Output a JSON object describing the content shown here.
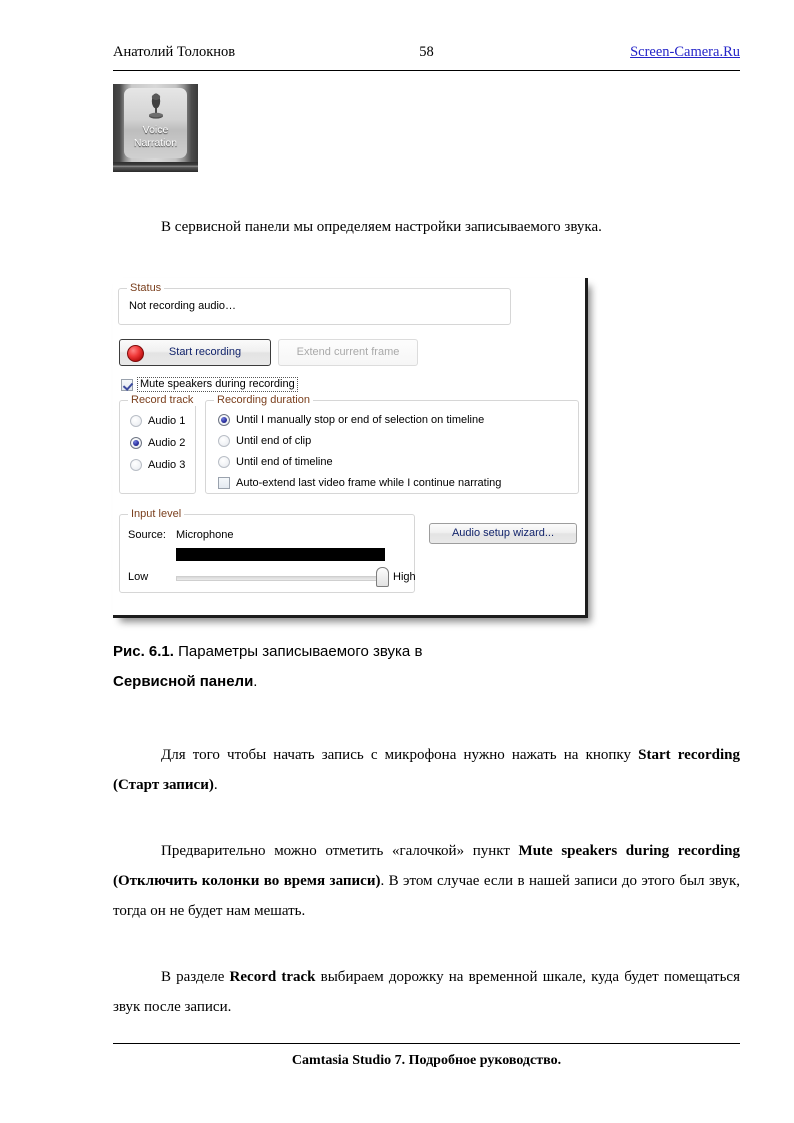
{
  "header": {
    "author": "Анатолий Толокнов",
    "page_number": "58",
    "link": "Screen-Camera.Ru",
    "link_color": "#2424c8"
  },
  "toolbutton": {
    "label_line1": "Voice",
    "label_line2": "Narration",
    "icon": "microphone-icon"
  },
  "intro_paragraph": "В сервисной панели мы определяем настройки записываемого звука.",
  "dialog": {
    "status": {
      "legend": "Status",
      "text": "Not recording audio…"
    },
    "buttons": {
      "start_recording": "Start recording",
      "extend_current_frame": "Extend current frame",
      "audio_setup_wizard": "Audio setup wizard..."
    },
    "mute": {
      "label": "Mute speakers during recording",
      "checked": true
    },
    "record_track": {
      "legend": "Record track",
      "options": [
        {
          "label": "Audio 1",
          "selected": false
        },
        {
          "label": "Audio 2",
          "selected": true
        },
        {
          "label": "Audio 3",
          "selected": false
        }
      ]
    },
    "recording_duration": {
      "legend": "Recording duration",
      "options": [
        {
          "label": "Until I manually stop or end of selection on timeline",
          "selected": true
        },
        {
          "label": "Until end of clip",
          "selected": false
        },
        {
          "label": "Until end of timeline",
          "selected": false
        }
      ],
      "auto_extend": {
        "label": "Auto-extend last video frame while I continue narrating",
        "checked": false
      }
    },
    "input_level": {
      "legend": "Input level",
      "source_label": "Source:",
      "source_value": "Microphone",
      "slider_low": "Low",
      "slider_high": "High"
    },
    "legend_color": "#7a3f1d",
    "button_text_color": "#12246b"
  },
  "caption": {
    "bold_prefix": "Рис. 6.1.",
    "text_part1": " Параметры записываемого звука в ",
    "bold_mid": "Сервисной панели",
    "text_part2": "."
  },
  "paragraphs": {
    "p1_a": "Для того чтобы начать запись с микрофона нужно нажать на кнопку ",
    "p1_b": "Start recording (Старт записи)",
    "p1_c": ".",
    "p2_a": "Предварительно можно отметить «галочкой» пункт ",
    "p2_b": "Mute speakers during recording (Отключить колонки во время записи)",
    "p2_c": ". В этом случае если в нашей записи до этого был звук, тогда он не будет нам мешать.",
    "p3_a": "В разделе ",
    "p3_b": "Record track",
    "p3_c": " выбираем дорожку на временной шкале, куда будет помещаться звук после записи."
  },
  "footer": {
    "text": "Camtasia Studio 7. Подробное руководство."
  }
}
